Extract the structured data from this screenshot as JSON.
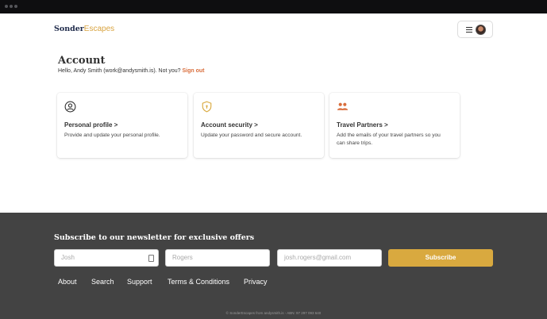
{
  "header": {
    "logo_part1": "Sonder",
    "logo_part2": "Escapes"
  },
  "account": {
    "title": "Account",
    "greeting": "Hello, Andy Smith (work@andysmith.is). Not you?",
    "signout_label": "Sign out"
  },
  "cards": [
    {
      "icon": "user-circle-icon",
      "title": "Personal profile >",
      "description": "Provide and update your personal profile."
    },
    {
      "icon": "shield-lock-icon",
      "title": "Account security >",
      "description": "Update your password and secure account."
    },
    {
      "icon": "people-icon",
      "title": "Travel Partners >",
      "description": "Add the emails of your travel partners so you can share trips."
    }
  ],
  "newsletter": {
    "title": "Subscribe to our newsletter for exclusive offers",
    "first_name_placeholder": "Josh",
    "last_name_placeholder": "Rogers",
    "email_placeholder": "josh.rogers@gmail.com",
    "subscribe_label": "Subscribe"
  },
  "footer_links": [
    "About",
    "Search",
    "Support",
    "Terms & Conditions",
    "Privacy"
  ],
  "copyright": "© SonderEscapes from andysmith.is - ABN: 97 297 093 640",
  "colors": {
    "accent": "#d9a93f",
    "signout": "#d96d3b",
    "footer_bg": "#434343",
    "navy": "#1e2a4a"
  }
}
